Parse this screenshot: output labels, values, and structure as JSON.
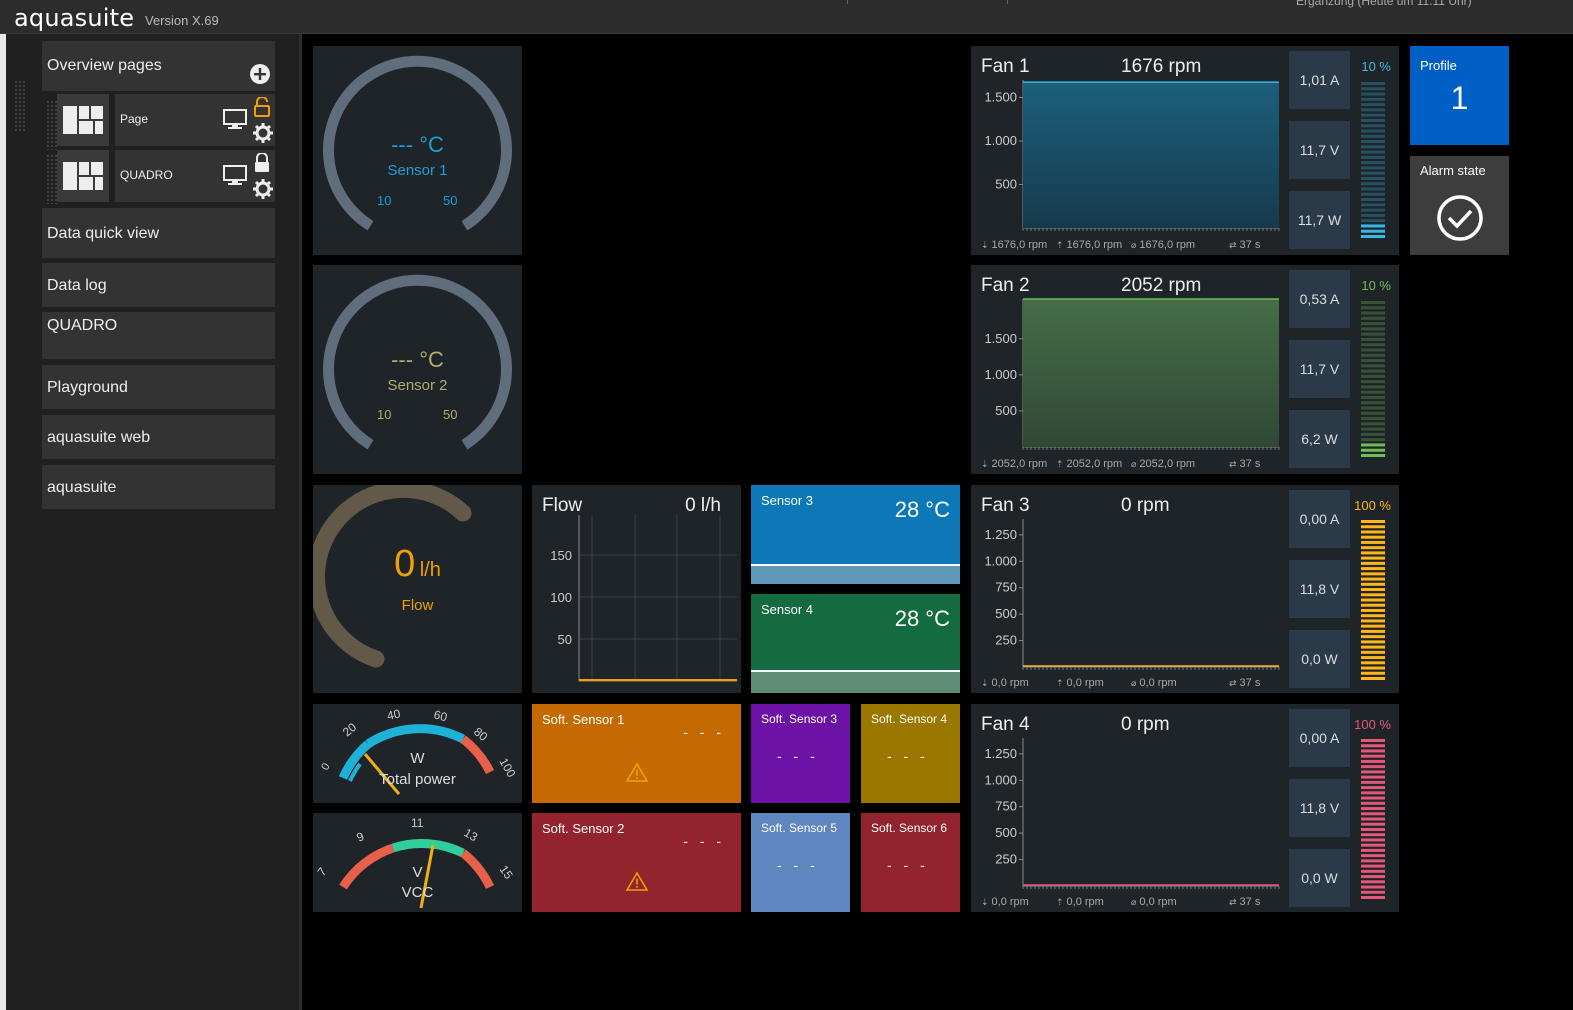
{
  "app": {
    "title": "aquasuite",
    "version": "Version X.69",
    "top_partial_text": "Ergänzung (Heute um 11:11 Uhr)"
  },
  "sidebar": {
    "overview": "Overview pages",
    "pages": [
      {
        "label": "Page",
        "lock": "unlocked"
      },
      {
        "label": "QUADRO",
        "lock": "locked"
      }
    ],
    "items": [
      "Data quick view",
      "Data log",
      "QUADRO",
      "Playground",
      "aquasuite web",
      "aquasuite"
    ]
  },
  "colors": {
    "cyan": "#1a9fd8",
    "olive": "#b0ac6a",
    "orange": "#f0a000",
    "fan1": "#38b8e8",
    "fan2": "#6cbf58",
    "fan3": "#ffb619",
    "fan4": "#e2577a"
  },
  "gauges": {
    "sensor1": {
      "value": "--- °C",
      "name": "Sensor 1",
      "min": "10",
      "max": "50"
    },
    "sensor2": {
      "value": "--- °C",
      "name": "Sensor 2",
      "min": "10",
      "max": "50"
    },
    "flow": {
      "value": "0",
      "unit": "l/h",
      "name": "Flow"
    },
    "power": {
      "unit": "W",
      "name": "Total power",
      "ticks": [
        "0",
        "20",
        "40",
        "60",
        "80",
        "100"
      ]
    },
    "vcc": {
      "unit": "V",
      "name": "VCC",
      "ticks": [
        "7",
        "9",
        "11",
        "13",
        "15"
      ]
    }
  },
  "flow_chart": {
    "title": "Flow",
    "value": "0 l/h",
    "ticks": [
      "150",
      "100",
      "50"
    ],
    "chart_data": {
      "type": "line",
      "ylim": [
        0,
        180
      ],
      "values": [
        0,
        0,
        0,
        0,
        0,
        0,
        0,
        0
      ]
    }
  },
  "sensors": {
    "s3": {
      "name": "Sensor 3",
      "value": "28 °C",
      "color": "#0c78b8"
    },
    "s4": {
      "name": "Sensor 4",
      "value": "28 °C",
      "color": "#136b3f"
    }
  },
  "soft": [
    {
      "name": "Soft. Sensor 1",
      "value": "- - -",
      "color": "#c46a00"
    },
    {
      "name": "Soft. Sensor 2",
      "value": "- - -",
      "color": "#93232d"
    },
    {
      "name": "Soft. Sensor 3",
      "value": "- - -",
      "color": "#6c12a4"
    },
    {
      "name": "Soft. Sensor 4",
      "value": "- - -",
      "color": "#9b7700"
    },
    {
      "name": "Soft. Sensor 5",
      "value": "- - -",
      "color": "#6086bf"
    },
    {
      "name": "Soft. Sensor 6",
      "value": "- - -",
      "color": "#93232d"
    }
  ],
  "fans": [
    {
      "name": "Fan 1",
      "rpm": "1676 rpm",
      "stats": [
        "1,01 A",
        "11,7 V",
        "11,7 W"
      ],
      "pct": "10 %",
      "ticks": [
        "1.500",
        "1.000",
        "500"
      ],
      "footer": [
        "1676,0 rpm",
        "1676,0 rpm",
        "1676,0 rpm",
        "37 s"
      ]
    },
    {
      "name": "Fan 2",
      "rpm": "2052 rpm",
      "stats": [
        "0,53 A",
        "11,7 V",
        "6,2 W"
      ],
      "pct": "10 %",
      "ticks": [
        "1.500",
        "1.000",
        "500"
      ],
      "footer": [
        "2052,0 rpm",
        "2052,0 rpm",
        "2052,0 rpm",
        "37 s"
      ]
    },
    {
      "name": "Fan 3",
      "rpm": "0 rpm",
      "stats": [
        "0,00 A",
        "11,8 V",
        "0,0 W"
      ],
      "pct": "100 %",
      "ticks": [
        "1.250",
        "1.000",
        "750",
        "500",
        "250"
      ],
      "footer": [
        "0,0 rpm",
        "0,0 rpm",
        "0,0 rpm",
        "37 s"
      ]
    },
    {
      "name": "Fan 4",
      "rpm": "0 rpm",
      "stats": [
        "0,00 A",
        "11,8 V",
        "0,0 W"
      ],
      "pct": "100 %",
      "ticks": [
        "1.250",
        "1.000",
        "750",
        "500",
        "250"
      ],
      "footer": [
        "0,0 rpm",
        "0,0 rpm",
        "0,0 rpm",
        "37 s"
      ]
    }
  ],
  "chart_data": [
    {
      "type": "area",
      "title": "Fan 1",
      "ylim": [
        0,
        1700
      ],
      "values": [
        1676,
        1676,
        1676,
        1676,
        1676,
        1676,
        1676,
        1676
      ]
    },
    {
      "type": "area",
      "title": "Fan 2",
      "ylim": [
        0,
        2052
      ],
      "values": [
        2052,
        2052,
        2052,
        2052,
        2052,
        2052,
        2052,
        2052
      ]
    },
    {
      "type": "area",
      "title": "Fan 3",
      "ylim": [
        0,
        1400
      ],
      "values": [
        0,
        0,
        0,
        0,
        0,
        0,
        0,
        0
      ]
    },
    {
      "type": "area",
      "title": "Fan 4",
      "ylim": [
        0,
        1400
      ],
      "values": [
        0,
        0,
        0,
        0,
        0,
        0,
        0,
        0
      ]
    }
  ],
  "profile": {
    "title": "Profile",
    "value": "1"
  },
  "alarm": {
    "title": "Alarm state"
  }
}
